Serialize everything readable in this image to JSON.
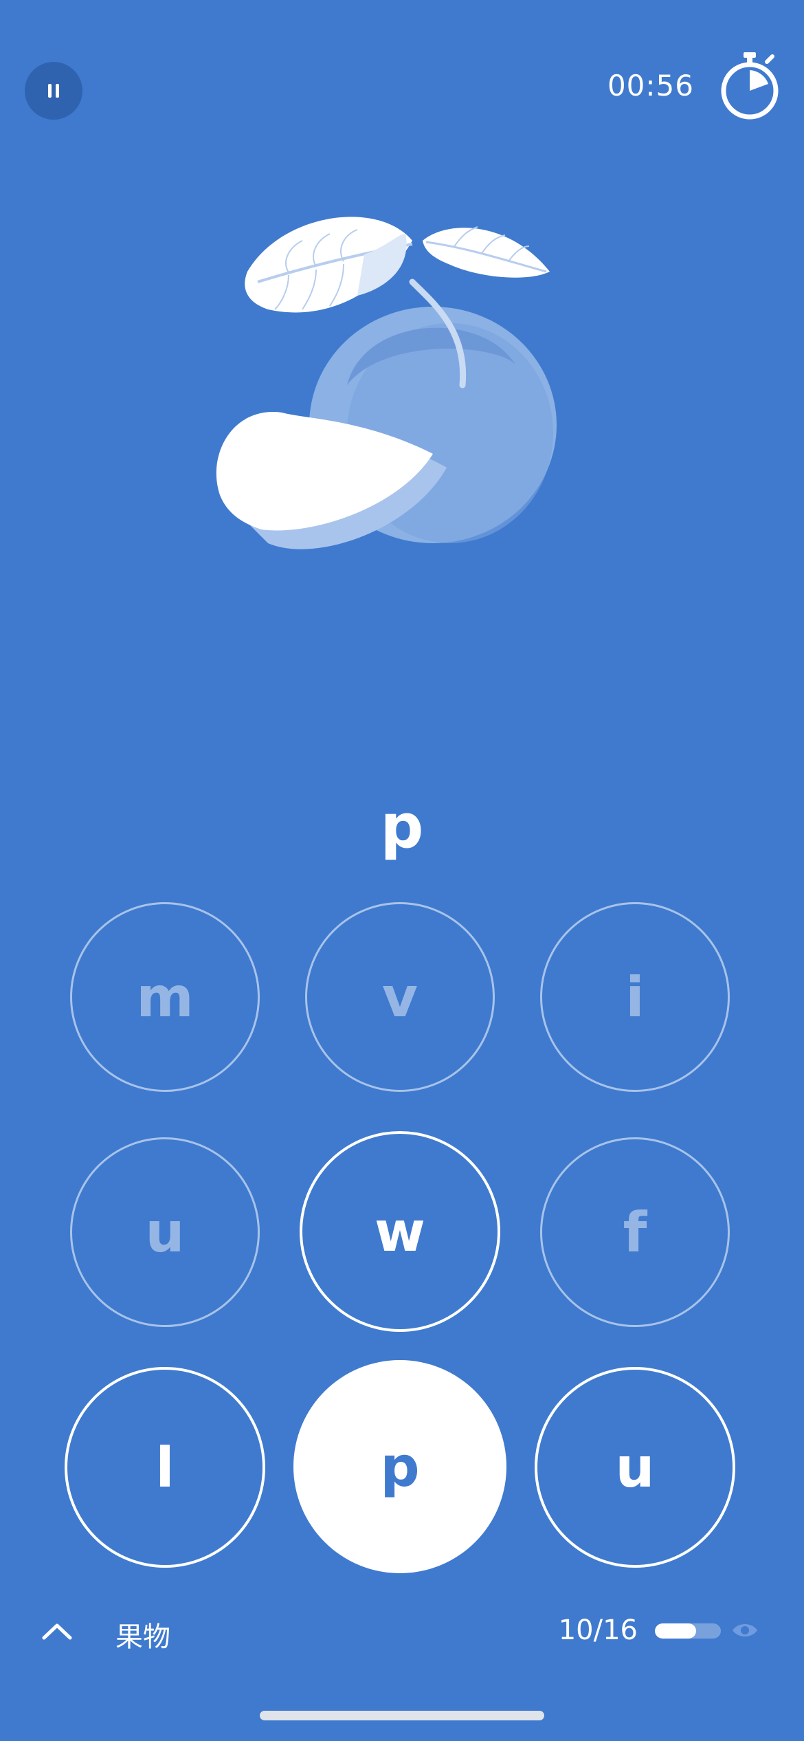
{
  "header": {
    "pause_icon": "pause-icon",
    "timer": "00:56",
    "stopwatch_icon": "stopwatch-icon"
  },
  "illustration": {
    "subject_icon": "fruit-illustration"
  },
  "prompt": {
    "letter": "p"
  },
  "keypad": {
    "keys": [
      "m",
      "v",
      "i",
      "u",
      "w",
      "f",
      "l",
      "p",
      "u"
    ],
    "selected_key": "p"
  },
  "footer": {
    "expand_icon": "chevron-up-icon",
    "category": "果物",
    "progress": "10/16",
    "progress_fraction": 0.625,
    "visibility_icon": "eye-icon"
  },
  "colors": {
    "background": "#3f7ace",
    "accent": "#ffffff"
  }
}
